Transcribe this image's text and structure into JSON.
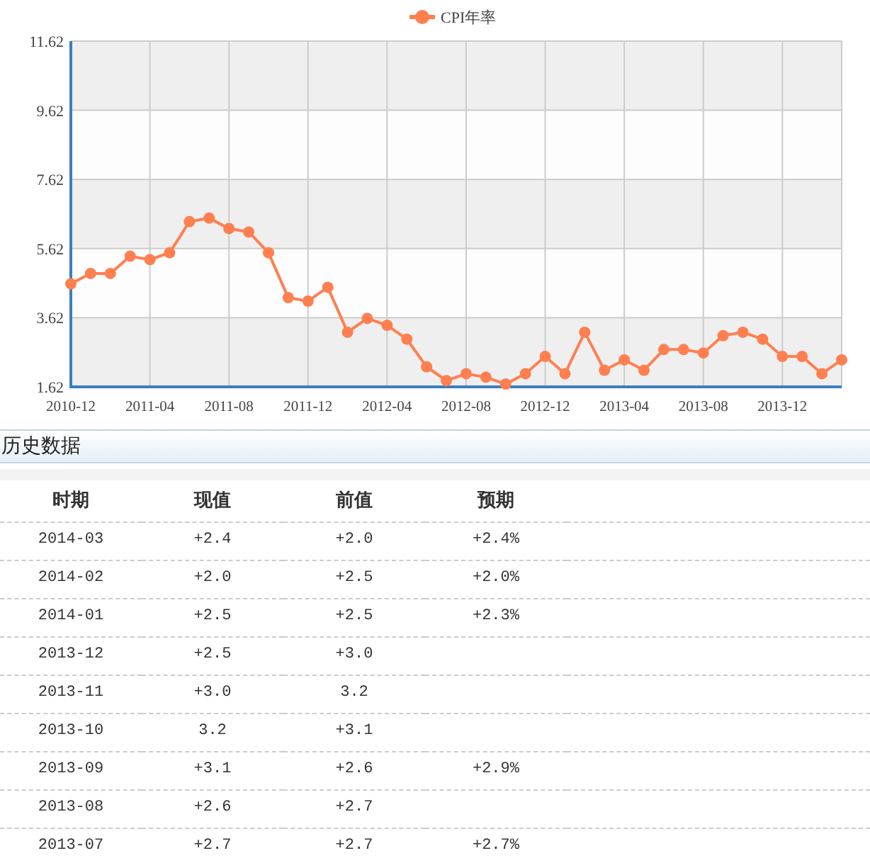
{
  "chart": {
    "chart_data": {
      "type": "line",
      "grid": true,
      "categories": [
        "2010-12",
        null,
        null,
        null,
        "2011-04",
        null,
        null,
        null,
        "2011-08",
        null,
        null,
        null,
        "2011-12",
        null,
        null,
        null,
        "2012-04",
        null,
        null,
        null,
        "2012-08",
        null,
        null,
        null,
        "2012-12",
        null,
        null,
        null,
        "2013-04",
        null,
        null,
        null,
        "2013-08",
        null,
        null,
        null,
        "2013-12",
        null,
        null,
        null
      ],
      "series": [
        {
          "name": "CPI年率",
          "color": "#ff7f50",
          "marker": "circle",
          "values": [
            4.6,
            4.9,
            4.9,
            5.4,
            5.3,
            5.5,
            6.4,
            6.5,
            6.2,
            6.1,
            5.5,
            4.2,
            4.1,
            4.5,
            3.2,
            3.6,
            3.4,
            3.0,
            2.2,
            1.8,
            2.0,
            1.9,
            1.7,
            2.0,
            2.5,
            2.0,
            3.2,
            2.1,
            2.4,
            2.1,
            2.7,
            2.7,
            2.6,
            3.1,
            3.2,
            3.0,
            2.5,
            2.5,
            2.0,
            2.4
          ]
        }
      ],
      "ylim": [
        1.62,
        11.62
      ],
      "yticks": [
        1.62,
        3.62,
        5.62,
        7.62,
        9.62,
        11.62
      ]
    }
  },
  "history": {
    "title": "历史数据",
    "columns": [
      "时期",
      "现值",
      "前值",
      "预期"
    ],
    "rows": [
      [
        "2014-03",
        "+2.4",
        "+2.0",
        "+2.4%"
      ],
      [
        "2014-02",
        "+2.0",
        "+2.5",
        "+2.0%"
      ],
      [
        "2014-01",
        "+2.5",
        "+2.5",
        "+2.3%"
      ],
      [
        "2013-12",
        "+2.5",
        "+3.0",
        ""
      ],
      [
        "2013-11",
        "+3.0",
        "3.2",
        ""
      ],
      [
        "2013-10",
        "3.2",
        "+3.1",
        ""
      ],
      [
        "2013-09",
        "+3.1",
        "+2.6",
        "+2.9%"
      ],
      [
        "2013-08",
        "+2.6",
        "+2.7",
        ""
      ],
      [
        "2013-07",
        "+2.7",
        "+2.7",
        "+2.7%"
      ]
    ]
  }
}
